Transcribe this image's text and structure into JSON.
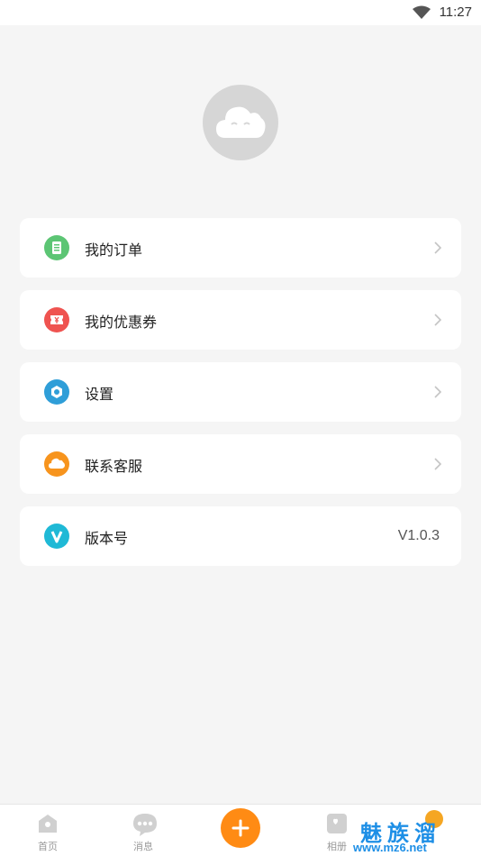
{
  "status_bar": {
    "time": "11:27",
    "wifi_icon": "wifi-icon"
  },
  "profile": {
    "avatar_icon": "cloud-avatar-icon"
  },
  "menu": [
    {
      "label": "我的订单",
      "icon": "order-icon",
      "icon_color": "#5cc574"
    },
    {
      "label": "我的优惠券",
      "icon": "coupon-icon",
      "icon_color": "#ef5350"
    },
    {
      "label": "设置",
      "icon": "settings-icon",
      "icon_color": "#2f9ed8"
    },
    {
      "label": "联系客服",
      "icon": "customer-service-icon",
      "icon_color": "#f7941d"
    },
    {
      "label": "版本号",
      "icon": "version-icon",
      "icon_color": "#1fb9d6",
      "value": "V1.0.3"
    }
  ],
  "tabbar": {
    "tabs": [
      {
        "label": "首页",
        "icon": "home-icon"
      },
      {
        "label": "消息",
        "icon": "message-icon"
      },
      {
        "label": "相册",
        "icon": "album-icon"
      }
    ],
    "add_icon": "plus-icon"
  },
  "watermark": {
    "big": "魅族溜",
    "small": "www.mz6.net"
  }
}
